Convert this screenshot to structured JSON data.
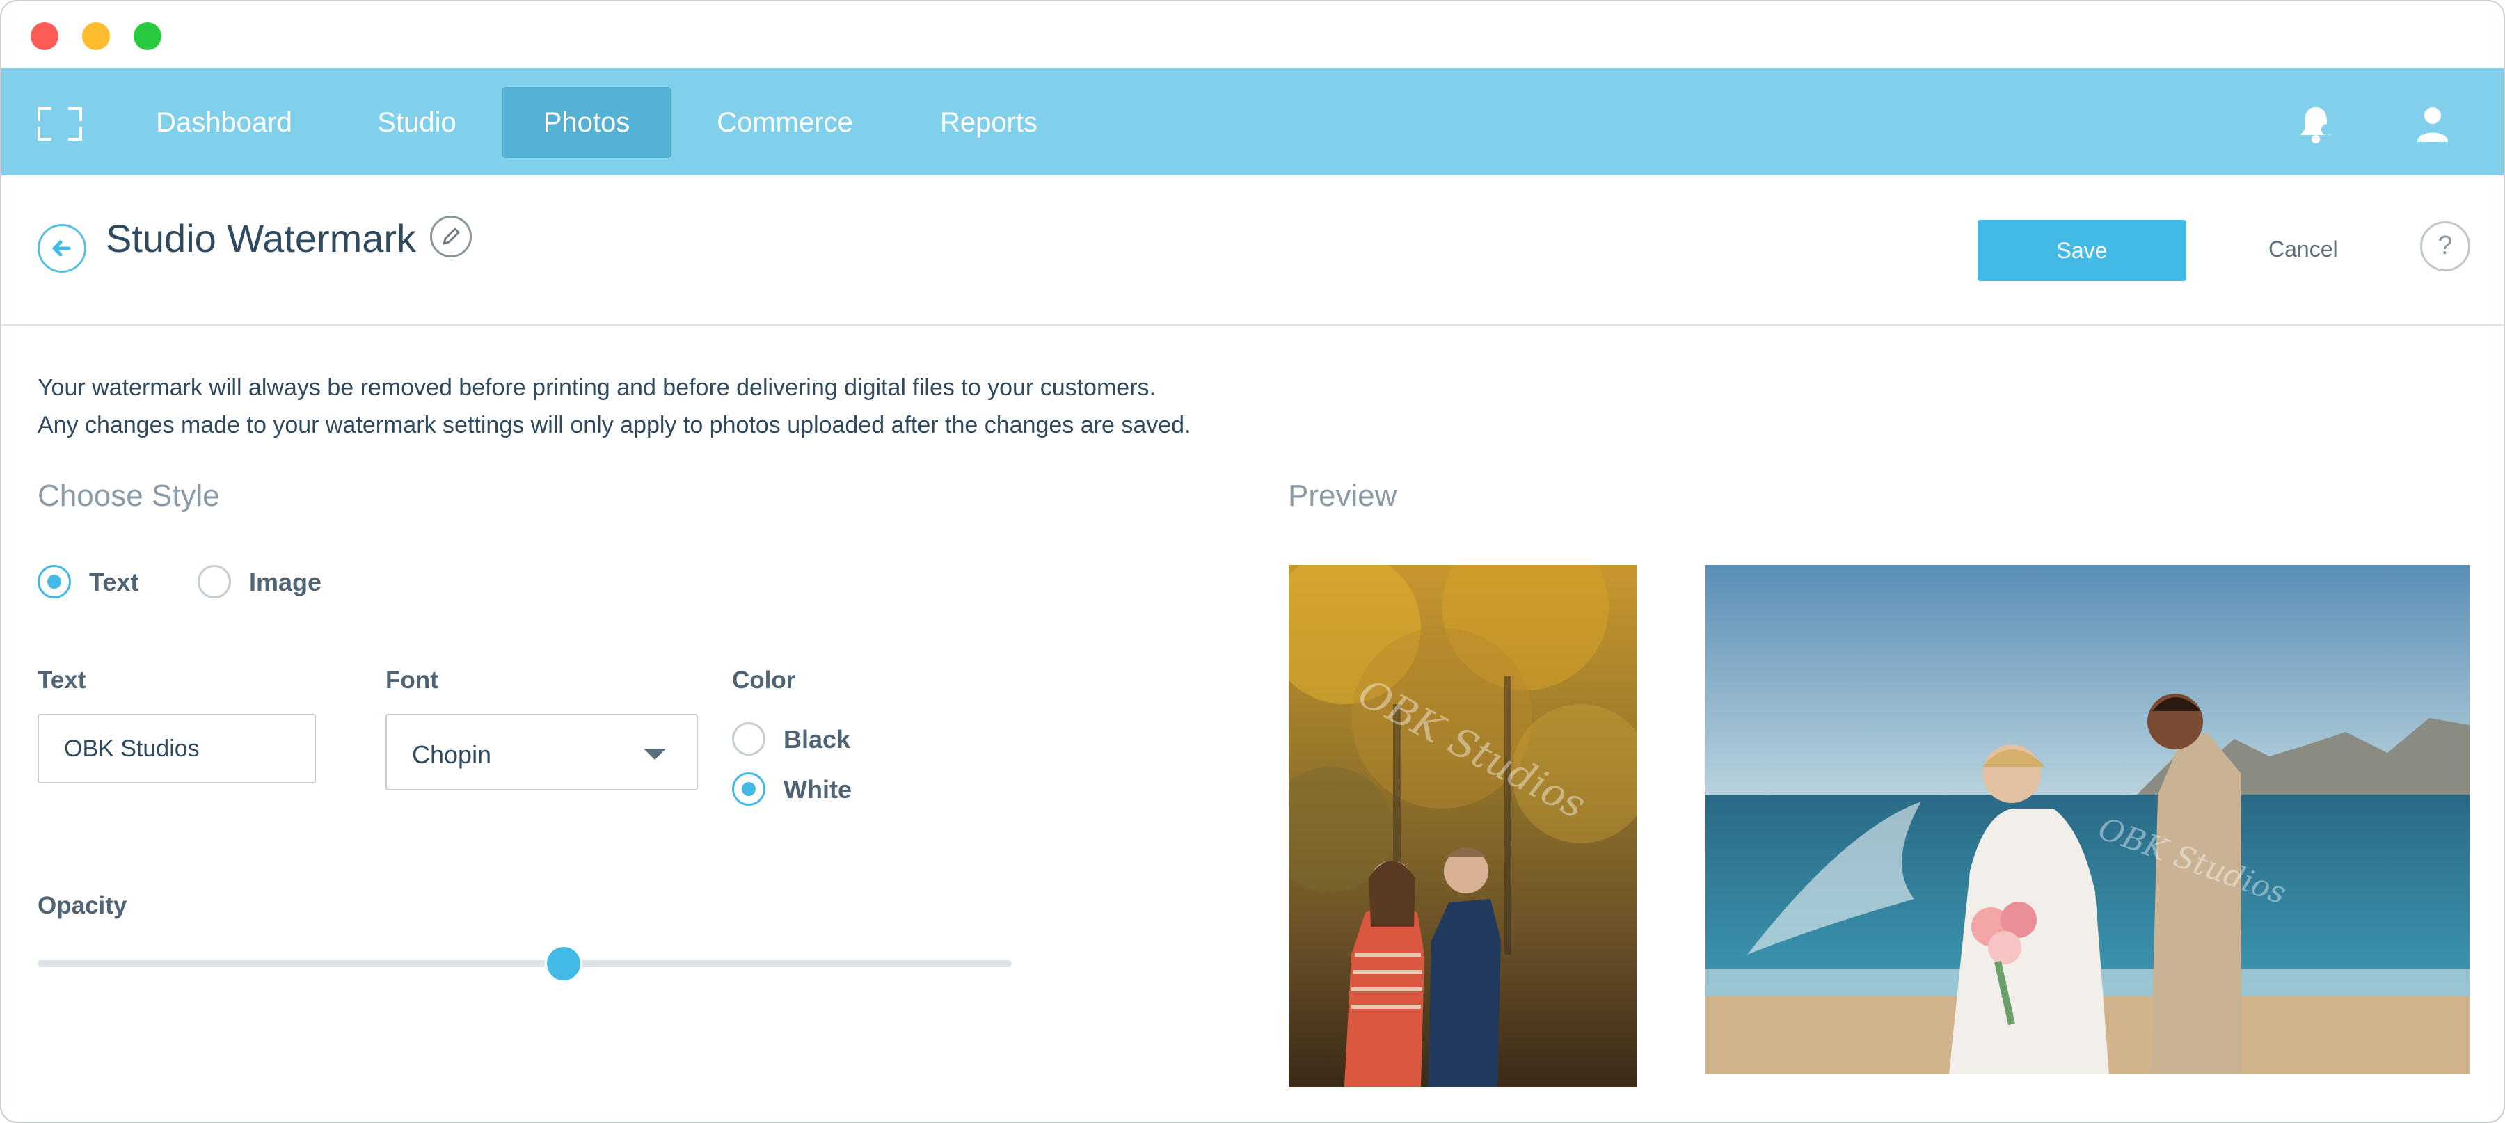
{
  "nav": {
    "items": [
      "Dashboard",
      "Studio",
      "Photos",
      "Commerce",
      "Reports"
    ],
    "active": "Photos"
  },
  "header": {
    "title": "Studio Watermark",
    "save_label": "Save",
    "cancel_label": "Cancel",
    "help_label": "?"
  },
  "notice": {
    "line1": "Your watermark will always be removed before printing and before delivering digital files to your customers.",
    "line2": "Any changes made to your watermark settings will only apply to photos uploaded after the changes are saved."
  },
  "style": {
    "title": "Choose Style",
    "options": [
      "Text",
      "Image"
    ],
    "selected": "Text"
  },
  "fields": {
    "text_label": "Text",
    "text_value": "OBK Studios",
    "font_label": "Font",
    "font_value": "Chopin",
    "color_label": "Color",
    "color_options": [
      "Black",
      "White"
    ],
    "color_selected": "White",
    "opacity_label": "Opacity",
    "opacity_value": 0.54
  },
  "preview": {
    "title": "Preview",
    "watermark_text": "OBK Studios"
  },
  "colors": {
    "nav_bg": "#80d0ec",
    "nav_active": "#55b1d3",
    "accent": "#43bae6",
    "text_dark": "#2f4a5e",
    "text_muted": "#8a9aa6"
  },
  "icons": {
    "nav_logo": "frame-corners-icon",
    "notifications": "bell-icon",
    "account": "user-icon",
    "back": "arrow-left-icon",
    "edit": "pencil-icon",
    "help": "question-icon",
    "dropdown": "caret-down-icon"
  }
}
